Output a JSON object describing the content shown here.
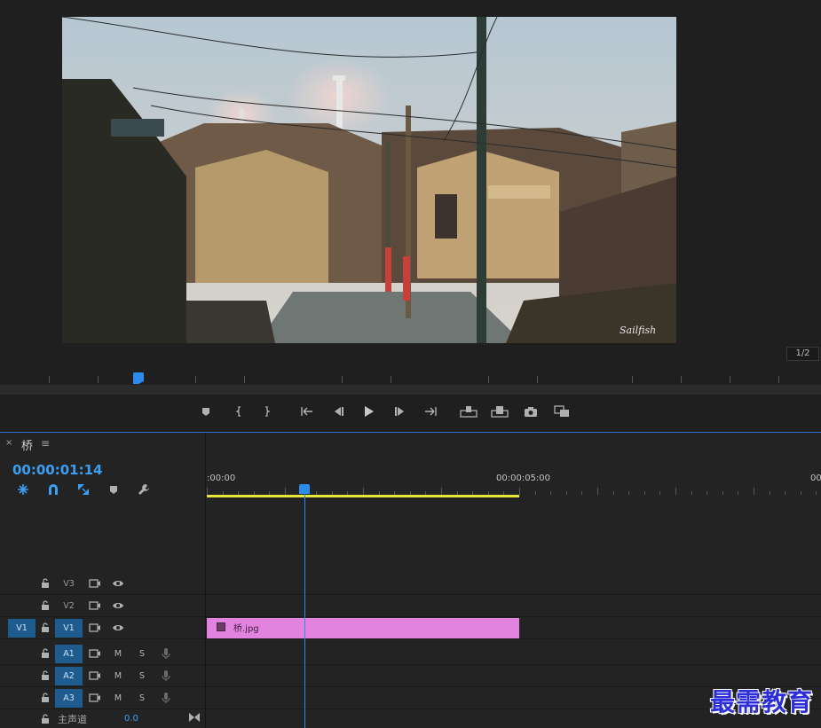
{
  "monitor": {
    "zoom_readout": "1/2",
    "video_signature": "Sailfish"
  },
  "transport": {
    "buttons": [
      "add-marker",
      "mark-in",
      "mark-out",
      "go-to-in",
      "step-back",
      "play",
      "step-forward",
      "go-to-out",
      "insert",
      "overwrite",
      "export-frame",
      "button-editor"
    ]
  },
  "timeline": {
    "tab_close": "×",
    "sequence_name": "桥",
    "tab_menu": "≡",
    "timecode": "00:00:01:14",
    "ruler": {
      "start_label": ":00:00",
      "mid_label": "00:00:05:00",
      "end_label": "00"
    },
    "tracks": {
      "video": [
        {
          "name": "V3",
          "targeted": false
        },
        {
          "name": "V2",
          "targeted": false
        },
        {
          "name": "V1",
          "targeted": true,
          "source": "V1"
        }
      ],
      "audio": [
        {
          "name": "A1",
          "mute": "M",
          "solo": "S"
        },
        {
          "name": "A2",
          "mute": "M",
          "solo": "S"
        },
        {
          "name": "A3",
          "mute": "M",
          "solo": "S"
        }
      ],
      "master": {
        "label": "主声道",
        "volume": "0.0"
      }
    },
    "clip": {
      "name": "桥.jpg",
      "color": "#e383e0"
    },
    "accent_color": "#2d8ceb",
    "work_area_color": "#e5e53a"
  },
  "watermark": "最需教育"
}
